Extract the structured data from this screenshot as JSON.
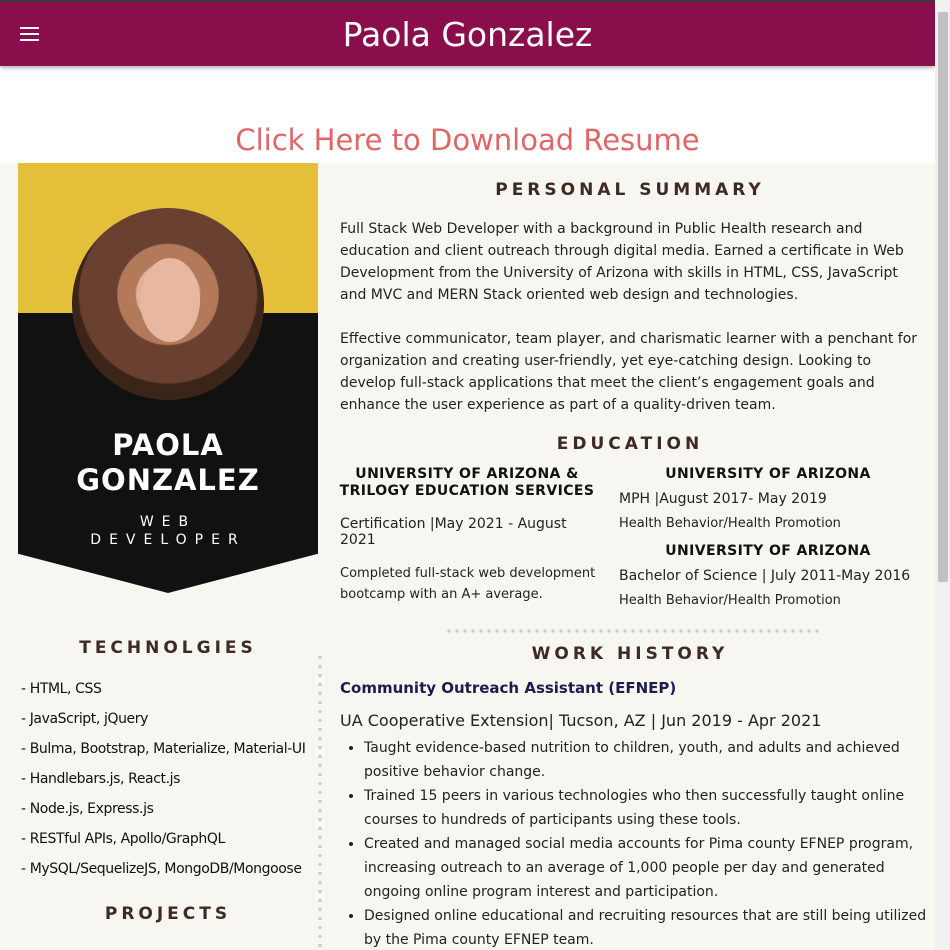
{
  "navbar": {
    "menu_icon": "hamburger-menu-icon",
    "title": "Paola Gonzalez",
    "color": "#8a0e4b"
  },
  "download": {
    "label": "Click Here to Download Resume",
    "color": "#e06666"
  },
  "resume": {
    "banner": {
      "name_line1": "PAOLA",
      "name_line2": "GONZALEZ",
      "title_line1": "WEB",
      "title_line2": "DEVELOPER",
      "accent": "#e4c03a"
    },
    "technologies": {
      "heading": "TECHNOLGIES",
      "items": [
        "- HTML, CSS",
        "- JavaScript, jQuery",
        "- Bulma, Bootstrap, Materialize, Material-UI",
        "- Handlebars.js, React.js",
        "- Node.js, Express.js",
        "- RESTful APIs, Apollo/GraphQL",
        "- MySQL/SequelizeJS, MongoDB/Mongoose"
      ]
    },
    "projects": {
      "heading": "PROJECTS"
    },
    "summary": {
      "heading": "PERSONAL SUMMARY",
      "paragraph1": "Full Stack Web Developer with a background in Public Health research and education and client outreach through digital media. Earned a certificate in Web Development from the University of Arizona with skills in HTML, CSS, JavaScript and MVC and MERN Stack oriented web design and technologies.",
      "paragraph2": "Effective communicator, team player, and charismatic learner with a penchant for organization and creating user-friendly, yet eye-catching design. Looking to develop full-stack applications that meet the client’s engagement goals and enhance the user experience as part of a quality-driven team."
    },
    "education": {
      "heading": "EDUCATION",
      "left": {
        "school": "UNIVERSITY OF ARIZONA & TRILOGY EDUCATION SERVICES",
        "degree": "Certification |May 2021 - August 2021",
        "detail": "Completed full-stack web development bootcamp with an A+ average."
      },
      "right1": {
        "school": "UNIVERSITY OF ARIZONA",
        "degree": "MPH |August 2017- May 2019",
        "detail": "Health Behavior/Health Promotion"
      },
      "right2": {
        "school": "UNIVERSITY OF ARIZONA",
        "degree": "Bachelor of Science | July 2011-May 2016",
        "detail": "Health Behavior/Health Promotion"
      }
    },
    "work": {
      "heading": "WORK HISTORY",
      "job_title": "Community Outreach Assistant (EFNEP)",
      "org": "UA Cooperative Extension| Tucson, AZ | Jun 2019 - Apr 2021",
      "bullets": [
        "Taught evidence-based nutrition to children, youth, and adults and achieved positive behavior change.",
        "Trained 15 peers in various technologies who then successfully taught online courses to hundreds of participants using these tools.",
        "Created and managed social media accounts for Pima county EFNEP program, increasing outreach to an average of 1,000 people per day and generated ongoing online program interest and participation.",
        "Designed online educational and recruiting resources that are still being utilized by the Pima county EFNEP team."
      ]
    }
  }
}
